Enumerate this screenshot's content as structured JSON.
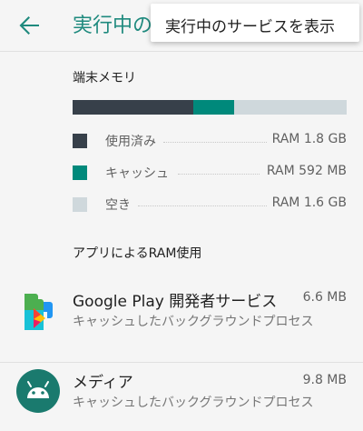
{
  "header": {
    "title": "実行中のサービス",
    "back_icon": "arrow-back-icon"
  },
  "overflow_menu": {
    "item": "実行中のサービスを表示"
  },
  "memory": {
    "section_label": "端末メモリ",
    "bar": [
      {
        "name": "used",
        "fraction": 0.44,
        "color": "#37404a"
      },
      {
        "name": "cache",
        "fraction": 0.15,
        "color": "#00897b"
      },
      {
        "name": "free",
        "fraction": 0.41,
        "color": "#cfd8dc"
      }
    ],
    "legend": [
      {
        "label": "使用済み",
        "value": "RAM 1.8 GB",
        "color": "#37404a"
      },
      {
        "label": "キャッシュ",
        "value": "RAM 592 MB",
        "color": "#00897b"
      },
      {
        "label": "空き",
        "value": "RAM 1.6 GB",
        "color": "#cfd8dc"
      }
    ]
  },
  "apps_section": {
    "label": "アプリによるRAM使用",
    "apps": [
      {
        "name": "Google Play 開発者サービス",
        "size": "6.6 MB",
        "desc": "キャッシュしたバックグラウンドプロセス",
        "icon": "google-play-services-icon"
      },
      {
        "name": "メディア",
        "size": "9.8 MB",
        "desc": "キャッシュしたバックグラウンドプロセス",
        "icon": "android-icon"
      }
    ]
  }
}
